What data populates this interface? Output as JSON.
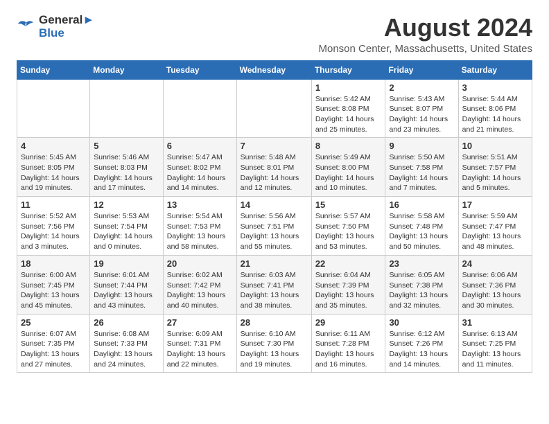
{
  "logo": {
    "line1": "General",
    "line2": "Blue"
  },
  "title": "August 2024",
  "subtitle": "Monson Center, Massachusetts, United States",
  "days_of_week": [
    "Sunday",
    "Monday",
    "Tuesday",
    "Wednesday",
    "Thursday",
    "Friday",
    "Saturday"
  ],
  "weeks": [
    [
      {
        "day": "",
        "info": ""
      },
      {
        "day": "",
        "info": ""
      },
      {
        "day": "",
        "info": ""
      },
      {
        "day": "",
        "info": ""
      },
      {
        "day": "1",
        "info": "Sunrise: 5:42 AM\nSunset: 8:08 PM\nDaylight: 14 hours and 25 minutes."
      },
      {
        "day": "2",
        "info": "Sunrise: 5:43 AM\nSunset: 8:07 PM\nDaylight: 14 hours and 23 minutes."
      },
      {
        "day": "3",
        "info": "Sunrise: 5:44 AM\nSunset: 8:06 PM\nDaylight: 14 hours and 21 minutes."
      }
    ],
    [
      {
        "day": "4",
        "info": "Sunrise: 5:45 AM\nSunset: 8:05 PM\nDaylight: 14 hours and 19 minutes."
      },
      {
        "day": "5",
        "info": "Sunrise: 5:46 AM\nSunset: 8:03 PM\nDaylight: 14 hours and 17 minutes."
      },
      {
        "day": "6",
        "info": "Sunrise: 5:47 AM\nSunset: 8:02 PM\nDaylight: 14 hours and 14 minutes."
      },
      {
        "day": "7",
        "info": "Sunrise: 5:48 AM\nSunset: 8:01 PM\nDaylight: 14 hours and 12 minutes."
      },
      {
        "day": "8",
        "info": "Sunrise: 5:49 AM\nSunset: 8:00 PM\nDaylight: 14 hours and 10 minutes."
      },
      {
        "day": "9",
        "info": "Sunrise: 5:50 AM\nSunset: 7:58 PM\nDaylight: 14 hours and 7 minutes."
      },
      {
        "day": "10",
        "info": "Sunrise: 5:51 AM\nSunset: 7:57 PM\nDaylight: 14 hours and 5 minutes."
      }
    ],
    [
      {
        "day": "11",
        "info": "Sunrise: 5:52 AM\nSunset: 7:56 PM\nDaylight: 14 hours and 3 minutes."
      },
      {
        "day": "12",
        "info": "Sunrise: 5:53 AM\nSunset: 7:54 PM\nDaylight: 14 hours and 0 minutes."
      },
      {
        "day": "13",
        "info": "Sunrise: 5:54 AM\nSunset: 7:53 PM\nDaylight: 13 hours and 58 minutes."
      },
      {
        "day": "14",
        "info": "Sunrise: 5:56 AM\nSunset: 7:51 PM\nDaylight: 13 hours and 55 minutes."
      },
      {
        "day": "15",
        "info": "Sunrise: 5:57 AM\nSunset: 7:50 PM\nDaylight: 13 hours and 53 minutes."
      },
      {
        "day": "16",
        "info": "Sunrise: 5:58 AM\nSunset: 7:48 PM\nDaylight: 13 hours and 50 minutes."
      },
      {
        "day": "17",
        "info": "Sunrise: 5:59 AM\nSunset: 7:47 PM\nDaylight: 13 hours and 48 minutes."
      }
    ],
    [
      {
        "day": "18",
        "info": "Sunrise: 6:00 AM\nSunset: 7:45 PM\nDaylight: 13 hours and 45 minutes."
      },
      {
        "day": "19",
        "info": "Sunrise: 6:01 AM\nSunset: 7:44 PM\nDaylight: 13 hours and 43 minutes."
      },
      {
        "day": "20",
        "info": "Sunrise: 6:02 AM\nSunset: 7:42 PM\nDaylight: 13 hours and 40 minutes."
      },
      {
        "day": "21",
        "info": "Sunrise: 6:03 AM\nSunset: 7:41 PM\nDaylight: 13 hours and 38 minutes."
      },
      {
        "day": "22",
        "info": "Sunrise: 6:04 AM\nSunset: 7:39 PM\nDaylight: 13 hours and 35 minutes."
      },
      {
        "day": "23",
        "info": "Sunrise: 6:05 AM\nSunset: 7:38 PM\nDaylight: 13 hours and 32 minutes."
      },
      {
        "day": "24",
        "info": "Sunrise: 6:06 AM\nSunset: 7:36 PM\nDaylight: 13 hours and 30 minutes."
      }
    ],
    [
      {
        "day": "25",
        "info": "Sunrise: 6:07 AM\nSunset: 7:35 PM\nDaylight: 13 hours and 27 minutes."
      },
      {
        "day": "26",
        "info": "Sunrise: 6:08 AM\nSunset: 7:33 PM\nDaylight: 13 hours and 24 minutes."
      },
      {
        "day": "27",
        "info": "Sunrise: 6:09 AM\nSunset: 7:31 PM\nDaylight: 13 hours and 22 minutes."
      },
      {
        "day": "28",
        "info": "Sunrise: 6:10 AM\nSunset: 7:30 PM\nDaylight: 13 hours and 19 minutes."
      },
      {
        "day": "29",
        "info": "Sunrise: 6:11 AM\nSunset: 7:28 PM\nDaylight: 13 hours and 16 minutes."
      },
      {
        "day": "30",
        "info": "Sunrise: 6:12 AM\nSunset: 7:26 PM\nDaylight: 13 hours and 14 minutes."
      },
      {
        "day": "31",
        "info": "Sunrise: 6:13 AM\nSunset: 7:25 PM\nDaylight: 13 hours and 11 minutes."
      }
    ]
  ]
}
